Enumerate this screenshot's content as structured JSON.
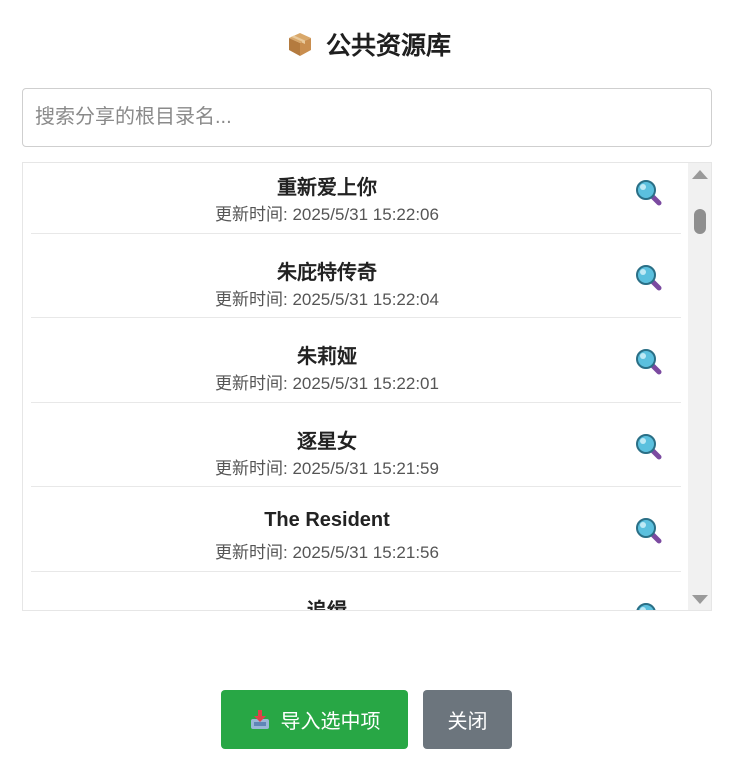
{
  "dialog": {
    "title": "公共资源库",
    "title_icon": "package-icon"
  },
  "search": {
    "placeholder": "搜索分享的根目录名...",
    "value": ""
  },
  "list": {
    "items": [
      {
        "name": "重新爱上你",
        "time": "更新时间: 2025/5/31 15:22:06",
        "icon": "magnifier-icon"
      },
      {
        "name": "朱庇特传奇",
        "time": "更新时间: 2025/5/31 15:22:04",
        "icon": "magnifier-icon"
      },
      {
        "name": "朱莉娅",
        "time": "更新时间: 2025/5/31 15:22:01",
        "icon": "magnifier-icon"
      },
      {
        "name": "逐星女",
        "time": "更新时间: 2025/5/31 15:21:59",
        "icon": "magnifier-icon"
      },
      {
        "name": "The Resident",
        "time": "更新时间: 2025/5/31 15:21:56",
        "icon": "magnifier-icon"
      },
      {
        "name": "追缉",
        "time": "",
        "icon": "magnifier-icon"
      }
    ]
  },
  "footer": {
    "import_label": "导入选中项",
    "import_icon": "inbox-tray-icon",
    "close_label": "关闭"
  },
  "colors": {
    "import_button": "#28a745",
    "close_button": "#6c757d",
    "magnifier_glass": "#5bc0de",
    "magnifier_handle": "#7b4aa0"
  }
}
